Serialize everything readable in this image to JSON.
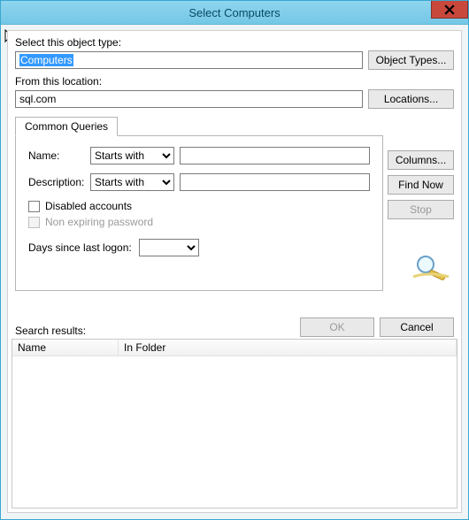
{
  "title": "Select Computers",
  "object": {
    "label": "Select this object type:",
    "value": "Computers",
    "button": "Object Types..."
  },
  "location": {
    "label": "From this location:",
    "value": "sql.com",
    "button": "Locations..."
  },
  "tabs": {
    "commonQueries": "Common Queries"
  },
  "queries": {
    "name_label": "Name:",
    "name_mode": "Starts with",
    "name_value": "",
    "desc_label": "Description:",
    "desc_mode": "Starts with",
    "desc_value": "",
    "disabled_accounts": "Disabled accounts",
    "non_expiring": "Non expiring password",
    "days_label": "Days since last logon:",
    "days_value": ""
  },
  "right": {
    "columns": "Columns...",
    "find_now": "Find Now",
    "stop": "Stop"
  },
  "ok": "OK",
  "cancel": "Cancel",
  "results": {
    "label": "Search results:",
    "col_name": "Name",
    "col_folder": "In Folder"
  }
}
